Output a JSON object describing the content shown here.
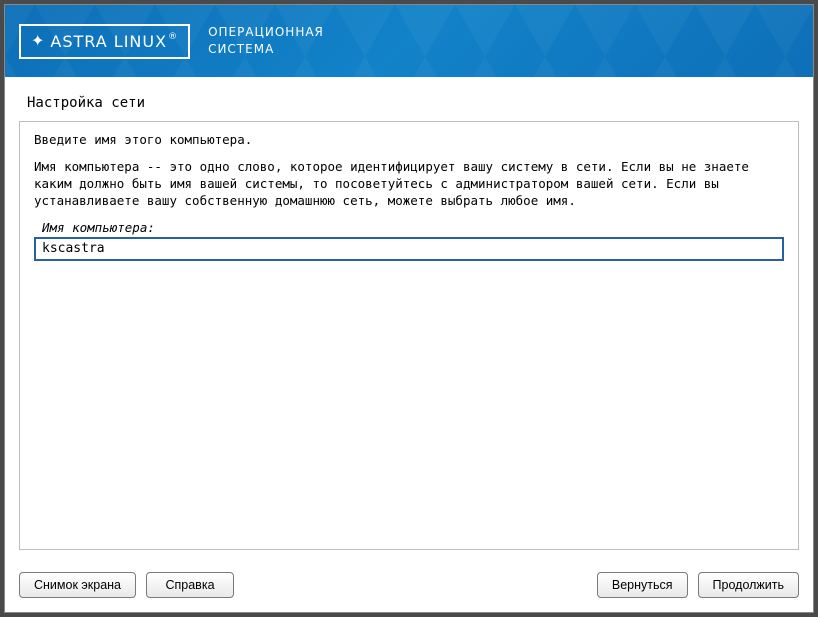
{
  "header": {
    "brand": "ASTRA LINUX",
    "subtitle_line1": "ОПЕРАЦИОННАЯ",
    "subtitle_line2": "СИСТЕМА"
  },
  "page": {
    "title": "Настройка сети"
  },
  "content": {
    "instruction1": "Введите имя этого компьютера.",
    "instruction2": "Имя компьютера -- это одно слово, которое идентифицирует вашу систему в сети. Если вы не знаете каким должно быть имя вашей системы, то посоветуйтесь с администратором вашей сети. Если вы устанавливаете вашу собственную домашнюю сеть, можете выбрать любое имя.",
    "field_label": "Имя компьютера:",
    "hostname_value": "kscastra"
  },
  "footer": {
    "screenshot": "Снимок экрана",
    "help": "Справка",
    "back": "Вернуться",
    "continue": "Продолжить"
  }
}
